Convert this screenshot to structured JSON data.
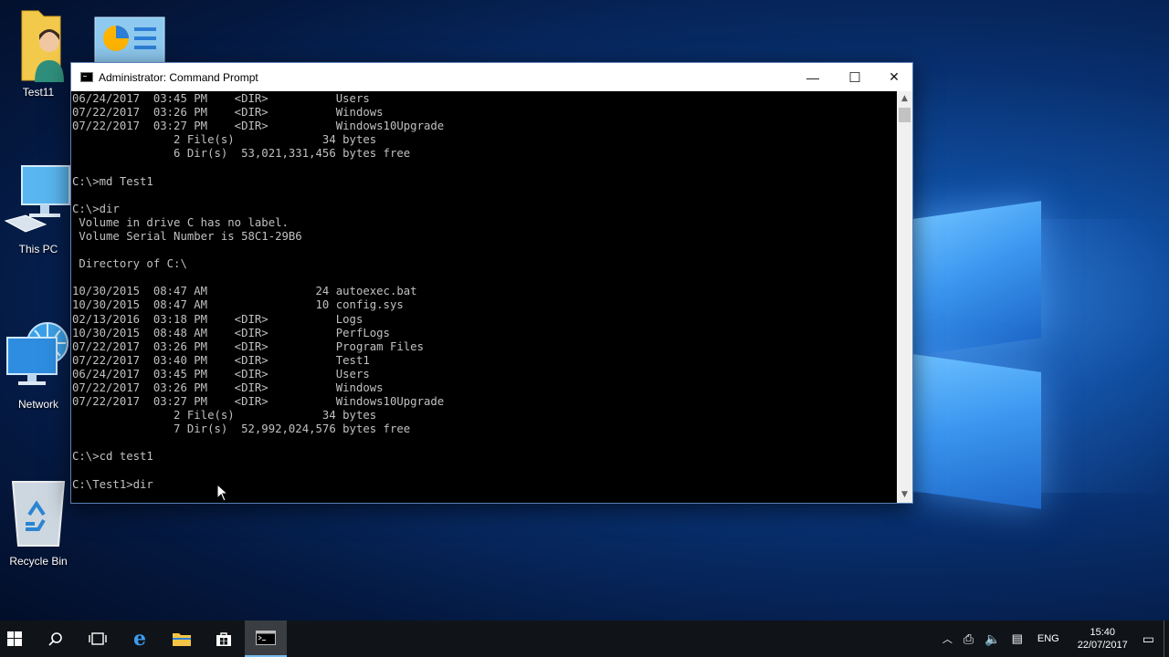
{
  "desktop": {
    "icons": [
      {
        "label": "Test11",
        "icon": "user-folder-icon"
      },
      {
        "label": "",
        "icon": "control-panel-icon"
      },
      {
        "label": "This PC",
        "icon": "computer-icon"
      },
      {
        "label": "Network",
        "icon": "network-icon"
      },
      {
        "label": "Recycle Bin",
        "icon": "recycle-bin-icon"
      }
    ]
  },
  "window": {
    "title": "Administrator: Command Prompt",
    "controls": {
      "minimize": "—",
      "maximize": "☐",
      "close": "✕"
    }
  },
  "console": {
    "lines": [
      "06/24/2017  03:45 PM    <DIR>          Users",
      "07/22/2017  03:26 PM    <DIR>          Windows",
      "07/22/2017  03:27 PM    <DIR>          Windows10Upgrade",
      "               2 File(s)             34 bytes",
      "               6 Dir(s)  53,021,331,456 bytes free",
      "",
      "C:\\>md Test1",
      "",
      "C:\\>dir",
      " Volume in drive C has no label.",
      " Volume Serial Number is 58C1-29B6",
      "",
      " Directory of C:\\",
      "",
      "10/30/2015  08:47 AM                24 autoexec.bat",
      "10/30/2015  08:47 AM                10 config.sys",
      "02/13/2016  03:18 PM    <DIR>          Logs",
      "10/30/2015  08:48 AM    <DIR>          PerfLogs",
      "07/22/2017  03:26 PM    <DIR>          Program Files",
      "07/22/2017  03:40 PM    <DIR>          Test1",
      "06/24/2017  03:45 PM    <DIR>          Users",
      "07/22/2017  03:26 PM    <DIR>          Windows",
      "07/22/2017  03:27 PM    <DIR>          Windows10Upgrade",
      "               2 File(s)             34 bytes",
      "               7 Dir(s)  52,992,024,576 bytes free",
      "",
      "C:\\>cd test1",
      "",
      "C:\\Test1>dir"
    ]
  },
  "taskbar": {
    "language": "ENG",
    "time": "15:40",
    "date": "22/07/2017"
  }
}
